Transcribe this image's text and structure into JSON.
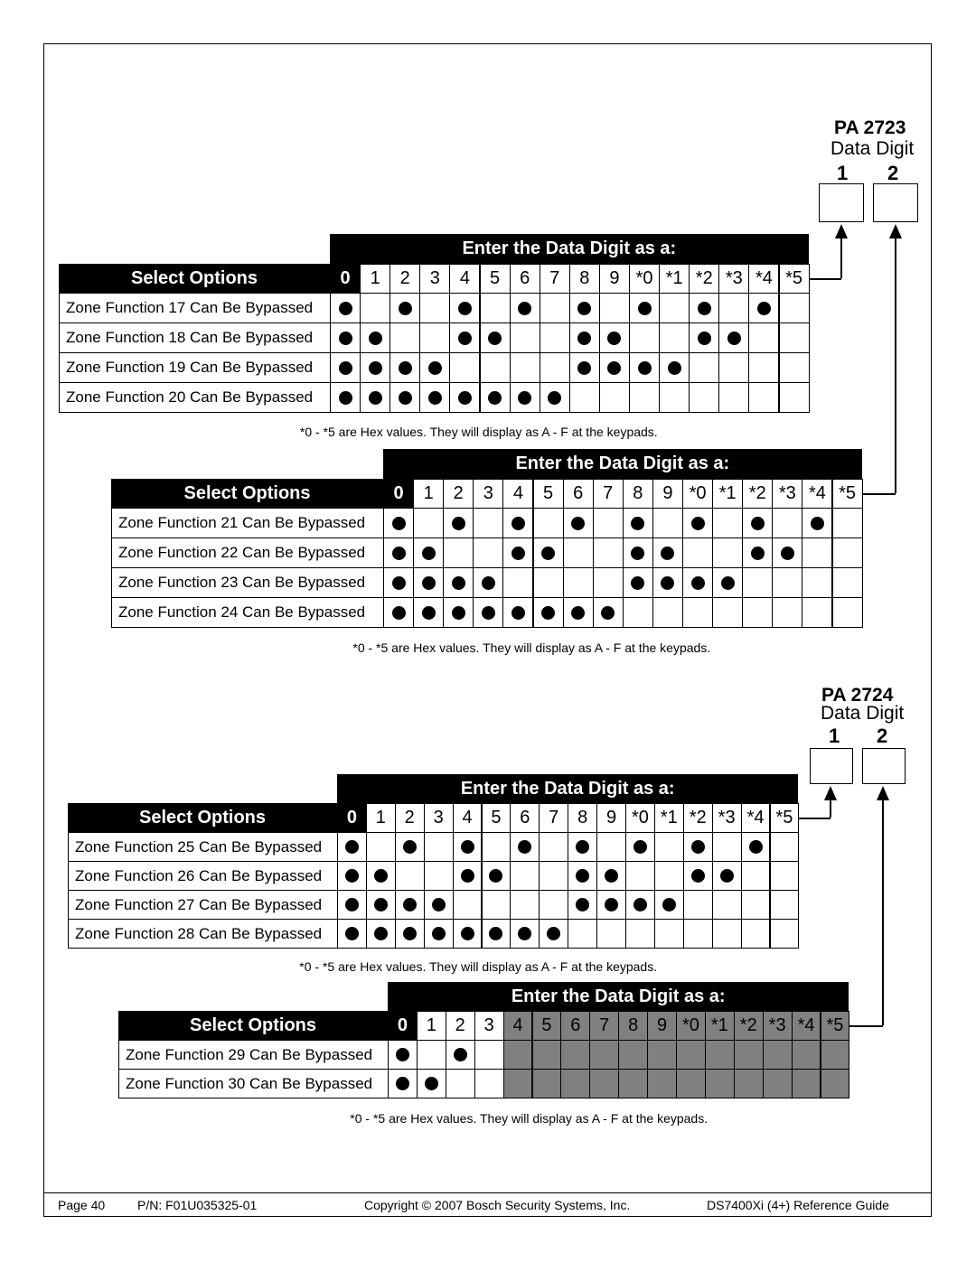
{
  "pa_2723": {
    "title": "PA 2723",
    "subtitle": "Data Digit",
    "digit1": "1",
    "digit2": "2"
  },
  "pa_2724": {
    "title": "PA 2724",
    "subtitle": "Data Digit",
    "digit1": "1",
    "digit2": "2"
  },
  "common": {
    "select_options": "Select Options",
    "enter_header": "Enter the Data Digit as a:",
    "digits": [
      "0",
      "1",
      "2",
      "3",
      "4",
      "5",
      "6",
      "7",
      "8",
      "9",
      "*0",
      "*1",
      "*2",
      "*3",
      "*4",
      "*5"
    ],
    "hex_note": "*0 - *5 are Hex values. They will display as A - F at the keypads."
  },
  "tables": [
    {
      "rows": [
        {
          "label": "Zone Function 17 Can Be Bypassed",
          "dots": [
            0,
            2,
            4,
            6,
            8,
            10,
            12,
            14
          ]
        },
        {
          "label": "Zone Function 18 Can Be Bypassed",
          "dots": [
            0,
            1,
            4,
            5,
            8,
            9,
            12,
            13
          ]
        },
        {
          "label": "Zone Function 19 Can Be Bypassed",
          "dots": [
            0,
            1,
            2,
            3,
            8,
            9,
            10,
            11
          ]
        },
        {
          "label": "Zone Function 20 Can Be Bypassed",
          "dots": [
            0,
            1,
            2,
            3,
            4,
            5,
            6,
            7
          ]
        }
      ],
      "disabled_from": 16
    },
    {
      "rows": [
        {
          "label": "Zone Function 21 Can Be Bypassed",
          "dots": [
            0,
            2,
            4,
            6,
            8,
            10,
            12,
            14
          ]
        },
        {
          "label": "Zone Function 22 Can Be Bypassed",
          "dots": [
            0,
            1,
            4,
            5,
            8,
            9,
            12,
            13
          ]
        },
        {
          "label": "Zone Function 23 Can Be Bypassed",
          "dots": [
            0,
            1,
            2,
            3,
            8,
            9,
            10,
            11
          ]
        },
        {
          "label": "Zone Function 24 Can Be Bypassed",
          "dots": [
            0,
            1,
            2,
            3,
            4,
            5,
            6,
            7
          ]
        }
      ],
      "disabled_from": 16
    },
    {
      "rows": [
        {
          "label": "Zone Function 25 Can Be Bypassed",
          "dots": [
            0,
            2,
            4,
            6,
            8,
            10,
            12,
            14
          ]
        },
        {
          "label": "Zone Function 26 Can Be Bypassed",
          "dots": [
            0,
            1,
            4,
            5,
            8,
            9,
            12,
            13
          ]
        },
        {
          "label": "Zone Function 27 Can Be Bypassed",
          "dots": [
            0,
            1,
            2,
            3,
            8,
            9,
            10,
            11
          ]
        },
        {
          "label": "Zone Function 28 Can Be Bypassed",
          "dots": [
            0,
            1,
            2,
            3,
            4,
            5,
            6,
            7
          ]
        }
      ],
      "disabled_from": 16
    },
    {
      "rows": [
        {
          "label": "Zone Function 29 Can Be Bypassed",
          "dots": [
            0,
            2
          ]
        },
        {
          "label": "Zone Function 30 Can Be Bypassed",
          "dots": [
            0,
            1
          ]
        }
      ],
      "disabled_from": 4
    }
  ],
  "colors": {
    "disabled": "#808080",
    "header": "#000000"
  },
  "footer": {
    "page": "Page 40",
    "part_number": "P/N: F01U035325-01",
    "copyright": "Copyright © 2007 Bosch Security Systems, Inc.",
    "guide": "DS7400Xi (4+) Reference Guide"
  }
}
